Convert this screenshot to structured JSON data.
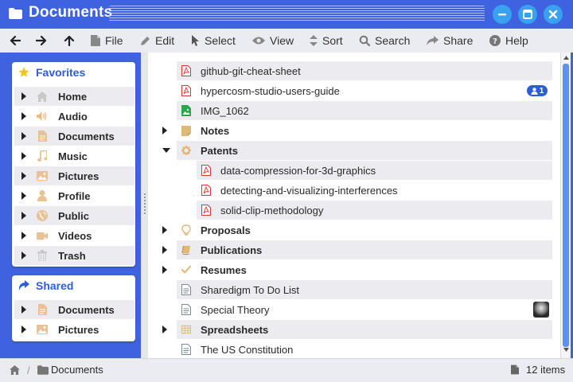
{
  "window": {
    "title": "Documents",
    "accent": "#3e62e0"
  },
  "toolbar": {
    "back_icon": "arrow-left-icon",
    "forward_icon": "arrow-right-icon",
    "up_icon": "arrow-up-icon",
    "items": [
      {
        "label": "File",
        "icon": "file-icon"
      },
      {
        "label": "Edit",
        "icon": "pencil-icon"
      },
      {
        "label": "Select",
        "icon": "cursor-icon"
      },
      {
        "label": "View",
        "icon": "eye-icon"
      },
      {
        "label": "Sort",
        "icon": "sort-icon"
      },
      {
        "label": "Search",
        "icon": "search-icon"
      },
      {
        "label": "Share",
        "icon": "share-icon"
      },
      {
        "label": "Help",
        "icon": "help-icon"
      }
    ]
  },
  "sidebar": {
    "favorites": {
      "title": "Favorites",
      "icon": "star-icon",
      "items": [
        {
          "label": "Home",
          "icon": "home-icon"
        },
        {
          "label": "Audio",
          "icon": "speaker-icon"
        },
        {
          "label": "Documents",
          "icon": "document-icon"
        },
        {
          "label": "Music",
          "icon": "music-note-icon"
        },
        {
          "label": "Pictures",
          "icon": "picture-icon"
        },
        {
          "label": "Profile",
          "icon": "user-icon"
        },
        {
          "label": "Public",
          "icon": "globe-icon"
        },
        {
          "label": "Videos",
          "icon": "video-camera-icon"
        },
        {
          "label": "Trash",
          "icon": "trash-icon"
        }
      ]
    },
    "shared": {
      "title": "Shared",
      "icon": "share-arrow-icon",
      "items": [
        {
          "label": "Documents",
          "icon": "document-icon"
        },
        {
          "label": "Pictures",
          "icon": "picture-icon"
        }
      ]
    }
  },
  "files": [
    {
      "name": "github-git-cheat-sheet",
      "type": "pdf",
      "level": 0,
      "kind": "file"
    },
    {
      "name": "hypercosm-studio-users-guide",
      "type": "pdf",
      "level": 0,
      "kind": "file",
      "badge": "1",
      "badge_icon": "users-icon"
    },
    {
      "name": "IMG_1062",
      "type": "image",
      "level": 0,
      "kind": "file"
    },
    {
      "name": "Notes",
      "type": "note-folder",
      "level": 0,
      "kind": "folder",
      "expanded": false
    },
    {
      "name": "Patents",
      "type": "gear-folder",
      "level": 0,
      "kind": "folder",
      "expanded": true
    },
    {
      "name": "data-compression-for-3d-graphics",
      "type": "pdf",
      "level": 1,
      "kind": "file"
    },
    {
      "name": "detecting-and-visualizing-interferences",
      "type": "pdf",
      "level": 1,
      "kind": "file"
    },
    {
      "name": "solid-clip-methodology",
      "type": "pdf",
      "level": 1,
      "kind": "file"
    },
    {
      "name": "Proposals",
      "type": "bulb-folder",
      "level": 0,
      "kind": "folder",
      "expanded": false
    },
    {
      "name": "Publications",
      "type": "book-folder",
      "level": 0,
      "kind": "folder",
      "expanded": false
    },
    {
      "name": "Resumes",
      "type": "check-folder",
      "level": 0,
      "kind": "folder",
      "expanded": false
    },
    {
      "name": "Sharedigm To Do List",
      "type": "text",
      "level": 0,
      "kind": "file"
    },
    {
      "name": "Special Theory",
      "type": "text",
      "level": 0,
      "kind": "file",
      "avatar": true
    },
    {
      "name": "Spreadsheets",
      "type": "grid-folder",
      "level": 0,
      "kind": "folder",
      "expanded": false
    },
    {
      "name": "The US Constitution",
      "type": "text",
      "level": 0,
      "kind": "file"
    }
  ],
  "statusbar": {
    "path": [
      "Documents"
    ],
    "separator": "/",
    "count": "12 items"
  }
}
